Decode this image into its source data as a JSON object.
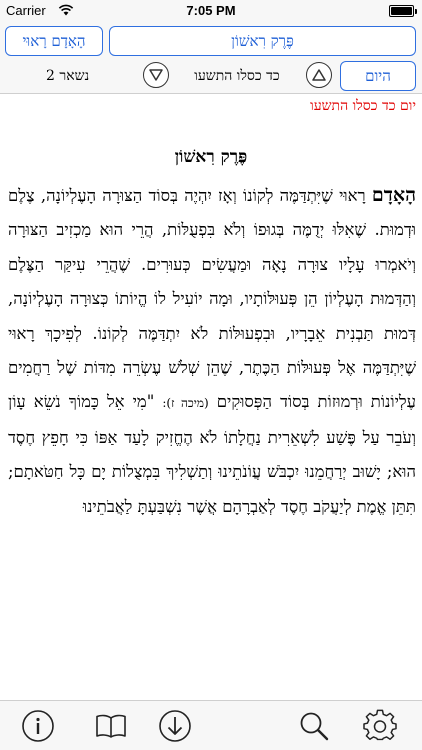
{
  "status_bar": {
    "carrier": "Carrier",
    "time": "7:05 PM"
  },
  "nav": {
    "left_button": "הָאָדָם רָאוּי",
    "title_button": "פֶּרֶק רִאשׁוֹן"
  },
  "date_nav": {
    "remaining": "נשאר 2",
    "date": "כד כסלו התשעו",
    "today_button": "היום"
  },
  "date_heading": "יום כד כסלו התשעו",
  "chapter_title": "פֶּרֶק רִאשׁוֹן",
  "text": {
    "lead": "הָאָדָם",
    "body": "רָאוּי שֶׁיִּתְדַּמֶּה לְקוֹנוֹ וְאָז יִהְיֶה בְּסוֹד הַצּוּרָה הָעֶלְיוֹנָה, צֶלֶם וּדְמוּת. שֶׁאִלּוּ יְדֻמֶּה בְּגוּפוֹ וְלֹא בִּפְעֻלּוֹת, הֲרֵי הוּא מַכְזִיב הַצּוּרָה וְיֹאמְרוּ עָלָיו צוּרָה נָאָה וּמַעֲשִׂים כְּעוּרִים. שֶׁהֲרֵי עִיקַּר הַצֶּלֶם וְהַדְּמוּת הָעֶלְיוֹן הֵן פְּעוּלּוֹתָיו, וּמָה יוֹעִיל לוֹ הֱיוֹתוֹ כְּצוּרָה הָעֶלְיוֹנָה, דְּמוּת תַּבְנִית אֵבָרָיו, וּבִפְעוּלּוֹת לֹא יִתְדַּמֶּה לְקוֹנוֹ. לְפִיכָךְ רָאוּי שֶׁיִּתְדַּמֶּה אֶל פְּעוּלּוֹת הַכֶּתֶר, שֶׁהֵן שְׁלֹשׁ עֶשְׂרֵה מִדּוֹת שֶׁל רַחֲמִים עֶלְיוֹנוֹת וּרְמוּזוֹת בְּסוֹד הַפְּסוּקִים",
    "source": "(מיכה ז):",
    "body2": "\"מִי אֵל כָּמוֹךָ נֹשֵׂא עָוֹן וְעֹבֵר עַל פֶּשַׁע לִשְׁאֵרִית נַחֲלָתוֹ לֹא הֶחֱזִיק לָעַד אַפּוֹ כִּי חָפֵץ חֶסֶד הוּא; יָשׁוּב יְרַחֲמֵנוּ יִכְבֹּשׁ עֲוֹנֹתֵינוּ וְתַשְׁלִיךְ בִּמְצֻלוֹת יָם כָּל חַטֹּאתָם; תִּתֵּן אֱמֶת לְיַעֲקֹב חֶסֶד לְאַבְרָהָם אֲשֶׁר נִשְׁבַּעְתָּ לַאֲבֹתֵינוּ"
  },
  "tab_bar": [
    "info-icon",
    "book-icon",
    "download-icon",
    "search-icon",
    "settings-icon"
  ],
  "colors": {
    "accent": "#1e5fd6",
    "date_heading": "#e10000"
  }
}
